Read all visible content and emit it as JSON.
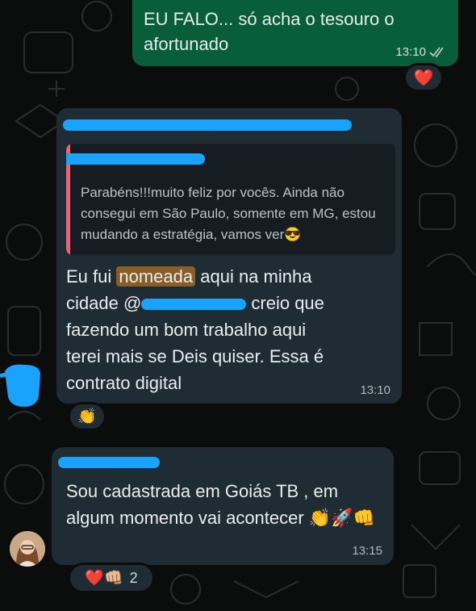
{
  "chat": {
    "out_message": {
      "text": "EU FALO... só acha o tesouro o afortunado",
      "time": "13:10",
      "reaction": "❤️"
    },
    "message_1": {
      "quote_text": "Parabéns!!!muito feliz por vocês. Ainda não consegui em São Paulo, somente em MG, estou mudando a estratégia, vamos ver😎",
      "text_part1": "Eu fui ",
      "highlight": "nomeada",
      "text_part2": " aqui na minha cidade @",
      "text_part3": " creio que fazendo um bom trabalho aqui terei mais se Deis quiser. Essa é contrato digital",
      "time": "13:10",
      "reaction": "👏"
    },
    "message_2": {
      "text": "Sou cadastrada em Goiás TB , em algum momento vai acontecer 👏🚀👊",
      "time": "13:15",
      "reactions": "❤️👊🏼",
      "reaction_count": "2"
    }
  },
  "colors": {
    "background": "#0b0d0c",
    "outgoing_bubble": "#075e39",
    "incoming_bubble": "#202c33",
    "quote_bar": "#e26779",
    "highlight": "#8a5d27",
    "redaction": "#19a3ff"
  }
}
